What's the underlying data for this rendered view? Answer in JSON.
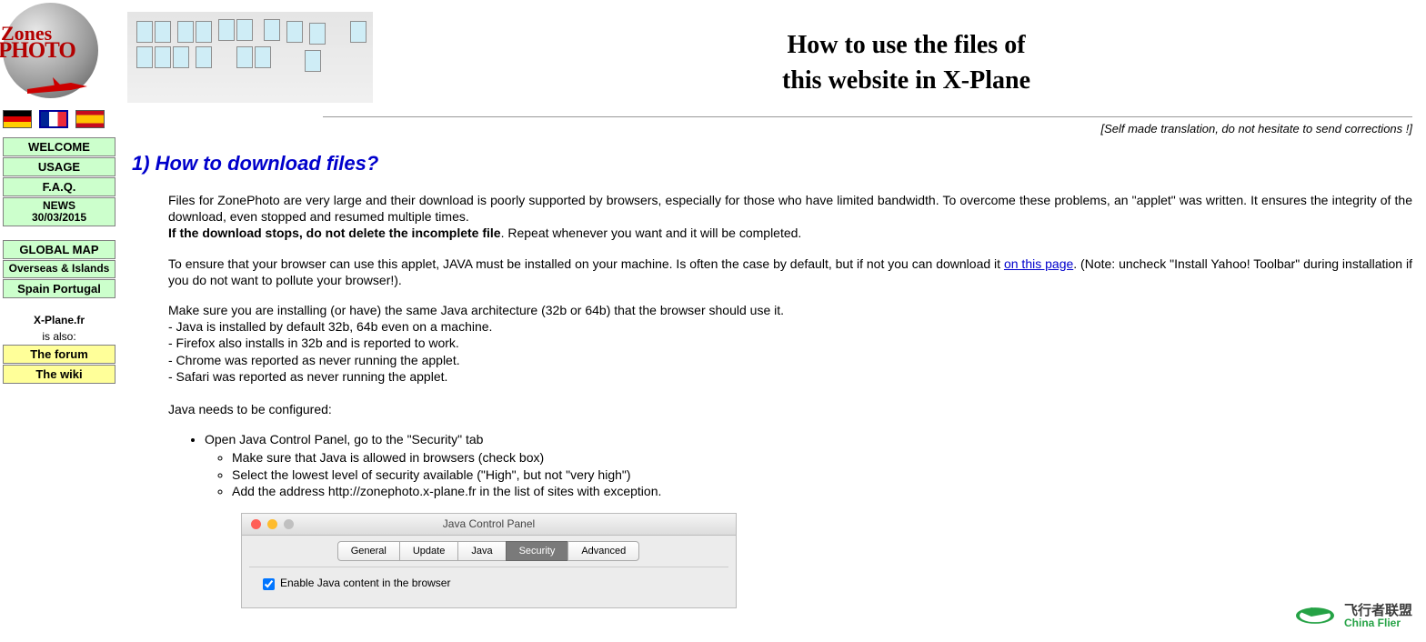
{
  "logo": {
    "line1": "Zones",
    "line2": "PHOTO"
  },
  "flags": [
    "de",
    "fr",
    "es"
  ],
  "nav": {
    "group1": [
      {
        "label": "WELCOME"
      },
      {
        "label": "USAGE"
      },
      {
        "label": "F.A.Q."
      },
      {
        "label": "NEWS",
        "sub": "30/03/2015"
      }
    ],
    "group2": [
      {
        "label": "GLOBAL MAP"
      },
      {
        "label": "Overseas & Islands"
      },
      {
        "label": "Spain Portugal"
      }
    ],
    "group3_header": "X-Plane.fr",
    "group3_sub": "is also:",
    "group3": [
      {
        "label": "The forum"
      },
      {
        "label": "The wiki"
      }
    ]
  },
  "title": {
    "line1": "How to use the files of",
    "line2": "this website in X-Plane"
  },
  "translation_note": "[Self made translation, do not hesitate to send corrections !]",
  "section_heading": "1) How to download files?",
  "para1": "Files for ZonePhoto are very large and their download is poorly supported by browsers, especially for those who have limited bandwidth. To overcome these problems, an \"applet\" was written. It ensures the integrity of the download, even stopped and resumed multiple times.",
  "para1_bold": "If the download stops, do not delete the incomplete file",
  "para1_tail": ". Repeat whenever you want and it will be completed.",
  "para2_a": "To ensure that your browser can use this applet, JAVA must be installed on your machine. Is often the case by default, but if not you can download it ",
  "para2_link": "on this page",
  "para2_b": ". (Note: uncheck \"Install Yahoo! Toolbar\" during installation if you do not want to pollute your browser!).",
  "para3_head": "Make sure you are installing (or have) the same Java architecture (32b or 64b) that the browser should use it.",
  "para3_lines": [
    "- Java is installed by default 32b, 64b even on a machine.",
    "- Firefox also installs in 32b and is reported to work.",
    "- Chrome was reported as never running the applet.",
    "- Safari was reported as never running the applet."
  ],
  "para4": "Java needs to be configured:",
  "list": {
    "item1": "Open Java Control Panel, go to the \"Security\" tab",
    "sub": [
      "Make sure that Java is allowed in browsers (check box)",
      "Select the lowest level of security available (\"High\", but not \"very high\")",
      "Add the address http://zonephoto.x-plane.fr in the list of sites with exception."
    ]
  },
  "jcp": {
    "title": "Java Control Panel",
    "tabs": [
      "General",
      "Update",
      "Java",
      "Security",
      "Advanced"
    ],
    "active_tab": "Security",
    "checkbox_label": "Enable Java content in the browser",
    "checked": true
  },
  "watermark": {
    "cn": "飞行者联盟",
    "en": "China Flier"
  }
}
